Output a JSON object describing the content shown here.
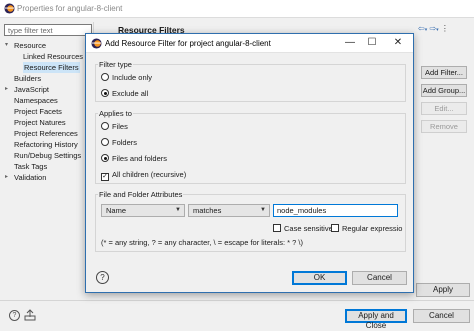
{
  "outer_window": {
    "title": "Properties for angular-8-client",
    "filter_placeholder": "type filter text",
    "tree": [
      {
        "label": "Resource",
        "indent": 0,
        "arrow": "▾",
        "selected": false
      },
      {
        "label": "Linked Resources",
        "indent": 1,
        "arrow": "",
        "selected": false
      },
      {
        "label": "Resource Filters",
        "indent": 1,
        "arrow": "",
        "selected": true
      },
      {
        "label": "Builders",
        "indent": 0,
        "arrow": "",
        "selected": false
      },
      {
        "label": "JavaScript",
        "indent": 0,
        "arrow": "▸",
        "selected": false
      },
      {
        "label": "Namespaces",
        "indent": 0,
        "arrow": "",
        "selected": false
      },
      {
        "label": "Project Facets",
        "indent": 0,
        "arrow": "",
        "selected": false
      },
      {
        "label": "Project Natures",
        "indent": 0,
        "arrow": "",
        "selected": false
      },
      {
        "label": "Project References",
        "indent": 0,
        "arrow": "",
        "selected": false
      },
      {
        "label": "Refactoring History",
        "indent": 0,
        "arrow": "",
        "selected": false
      },
      {
        "label": "Run/Debug Settings",
        "indent": 0,
        "arrow": "",
        "selected": false
      },
      {
        "label": "Task Tags",
        "indent": 0,
        "arrow": "",
        "selected": false
      },
      {
        "label": "Validation",
        "indent": 0,
        "arrow": "▸",
        "selected": false
      }
    ],
    "page_title": "Resource Filters",
    "side_buttons": {
      "add_filter": "Add Filter...",
      "add_group": "Add Group...",
      "edit": "Edit...",
      "remove": "Remove"
    },
    "apply_label": "Apply",
    "apply_close_label": "Apply and Close",
    "cancel_label": "Cancel"
  },
  "dialog": {
    "title": "Add Resource Filter for project angular-8-client",
    "filter_type": {
      "label": "Filter type",
      "include_only": "Include only",
      "exclude_all": "Exclude all",
      "selected": "exclude_all"
    },
    "applies_to": {
      "label": "Applies to",
      "files": "Files",
      "folders": "Folders",
      "files_and_folders": "Files and folders",
      "selected": "files_and_folders",
      "all_children_label": "All children (recursive)",
      "all_children_checked": true
    },
    "attributes": {
      "label": "File and Folder Attributes",
      "attribute_value": "Name",
      "operator_value": "matches",
      "pattern_value": "node_modules",
      "case_sensitive_label": "Case sensitive",
      "regex_label": "Regular expressio",
      "hint": "(* = any string, ? = any character, \\ = escape for literals: * ? \\)"
    },
    "ok_label": "OK",
    "cancel_label": "Cancel",
    "help_glyph": "?"
  },
  "colors": {
    "accent": "#0078d7",
    "selection": "#cce4f7",
    "window_bg": "#f0f0f0"
  }
}
